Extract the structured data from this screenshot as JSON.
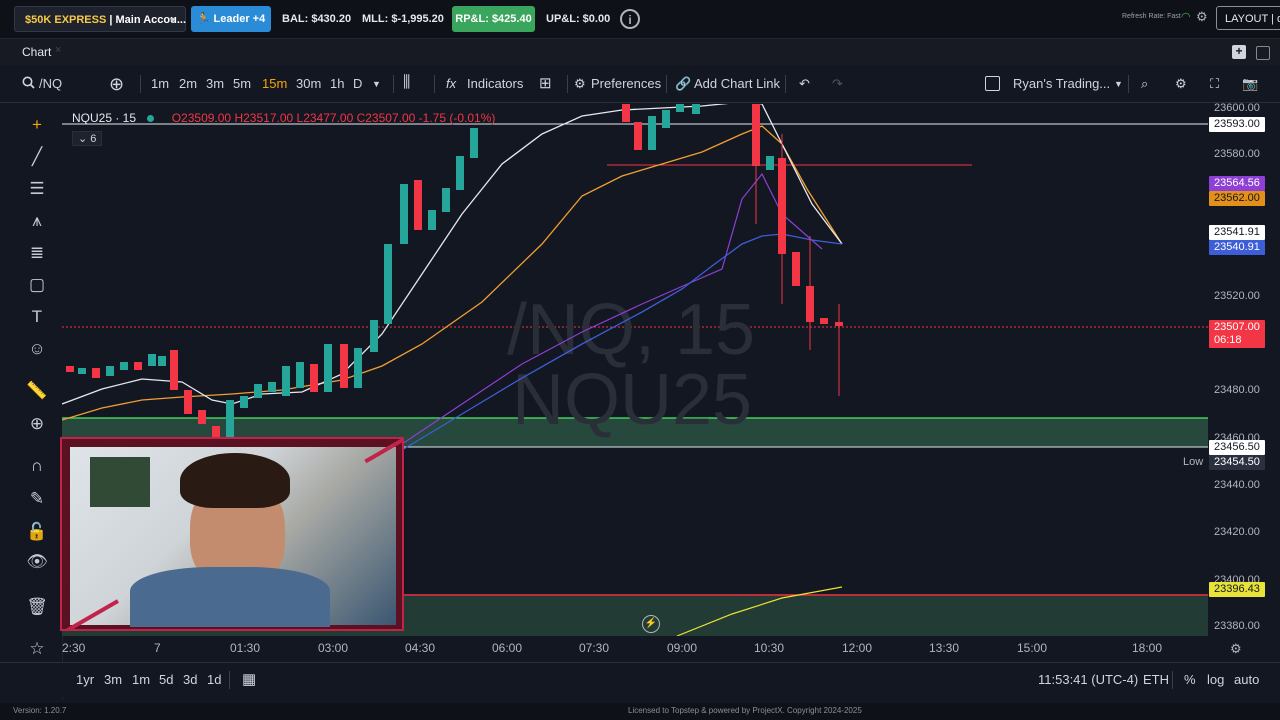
{
  "topbar": {
    "account": "$50K EXPRESS | Main Accou...",
    "account_a1": "$50K EXPRESS",
    "account_a2": " | Main Accou...",
    "leader": "Leader +4",
    "bal": "BAL: $430.20",
    "mll": "MLL: $-1,995.20",
    "rpl": "RP&L: $425.40",
    "upl": "UP&L: $0.00",
    "refresh": "Refresh Rate: Fast",
    "layout": "LAYOUT | de"
  },
  "panel": {
    "title": "Chart",
    "close": "×",
    "add": "+"
  },
  "toolbar": {
    "symbol": "/NQ",
    "timeframes": [
      "1m",
      "2m",
      "3m",
      "5m",
      "15m",
      "30m",
      "1h",
      "D"
    ],
    "indicators": "Indicators",
    "preferences": "Preferences",
    "add_chart_link": "Add Chart Link",
    "template": "Ryan's Trading..."
  },
  "legend": {
    "symbol": "NQU25 · 15",
    "o": "O23509.00",
    "h": "H23517.00",
    "l": "L23477.00",
    "c": "C23507.00",
    "chg": "-1.75 (-0.01%)",
    "indicators_count": "6"
  },
  "watermark": {
    "line1": "/NQ, 15",
    "line2": "NQU25"
  },
  "price_axis": {
    "ticks": [
      "23600.00",
      "23580.00",
      "23520.00",
      "23480.00",
      "23460.00",
      "23440.00",
      "23420.00",
      "23400.00",
      "23380.00"
    ],
    "labels": [
      {
        "text": "23593.00",
        "bg": "#ffffff",
        "fg": "#131722"
      },
      {
        "text": "23564.56",
        "bg": "#8e3fd6",
        "fg": "#ffffff"
      },
      {
        "text": "23562.00",
        "bg": "#e3901a",
        "fg": "#131722"
      },
      {
        "text": "23541.91",
        "bg": "#ffffff",
        "fg": "#131722"
      },
      {
        "text": "23540.91",
        "bg": "#3d5ed6",
        "fg": "#ffffff"
      },
      {
        "text": "23456.50",
        "bg": "#ffffff",
        "fg": "#131722"
      },
      {
        "text": "23454.50",
        "bg": "#2a3040",
        "fg": "#ffffff"
      },
      {
        "text": "23396.43",
        "bg": "#e8e337",
        "fg": "#131722"
      }
    ],
    "last_price": "23507.00",
    "countdown": "06:18",
    "low_label": "Low"
  },
  "time_axis": [
    "2:30",
    "7",
    "01:30",
    "03:00",
    "04:30",
    "06:00",
    "07:30",
    "09:00",
    "10:30",
    "12:00",
    "13:30",
    "15:00",
    "18:00"
  ],
  "bottombar": {
    "ranges": [
      "1yr",
      "3m",
      "1m",
      "5d",
      "3d",
      "1d"
    ],
    "clock": "11:53:41 (UTC-4)",
    "session": "ETH",
    "percent": "%",
    "log": "log",
    "auto": "auto"
  },
  "footer": {
    "version": "Version: 1.20.7",
    "license": "Licensed to Topstep & powered by ProjectX. Copyright 2024-2025"
  },
  "colors": {
    "bull": "#26a69a",
    "bear": "#f23645",
    "support_zone": "#2f5a45",
    "accent": "#f7a600"
  }
}
